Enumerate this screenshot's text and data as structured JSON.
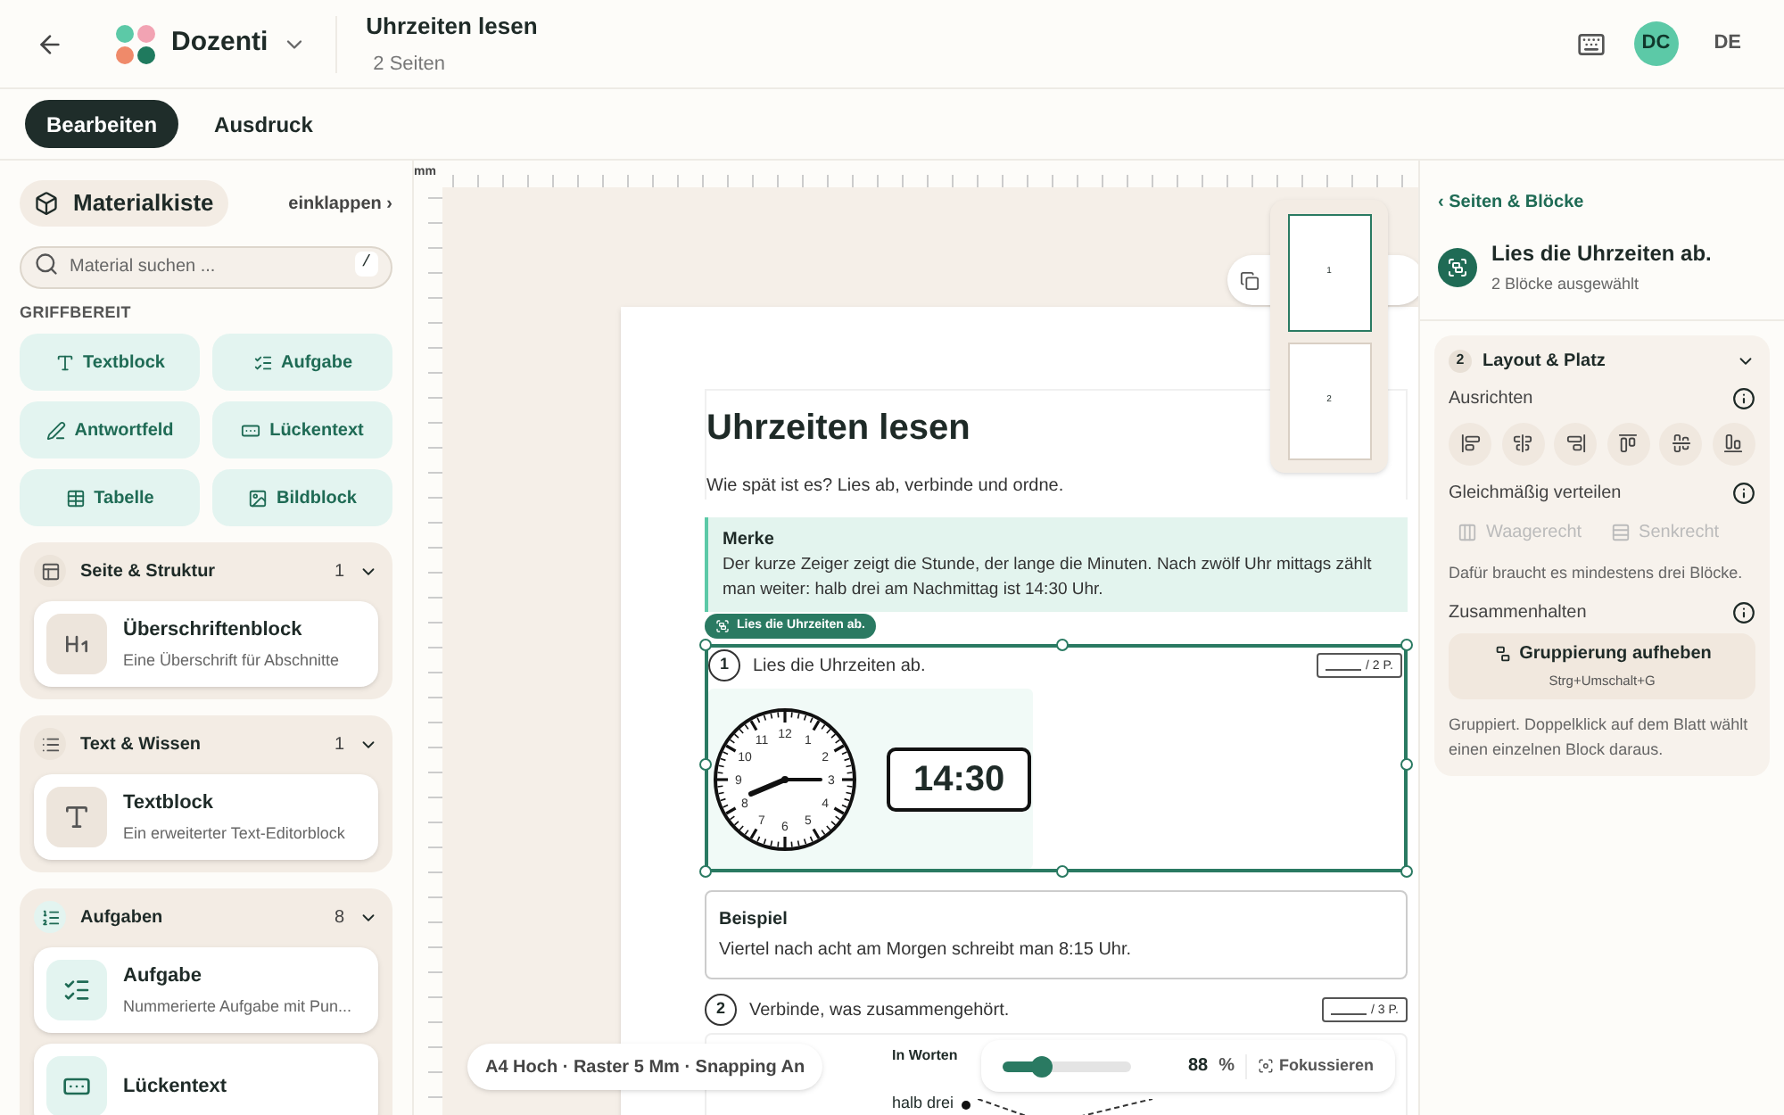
{
  "header": {
    "brand": "Dozenti",
    "title": "Uhrzeiten lesen",
    "subtitle": "2 Seiten",
    "avatar": "DC",
    "language": "DE"
  },
  "tabs": [
    {
      "label": "Bearbeiten",
      "selected": true
    },
    {
      "label": "Ausdruck",
      "selected": false
    }
  ],
  "sidebar": {
    "title": "Materialkiste",
    "collapse": "einklappen ›",
    "search": {
      "placeholder": "Material suchen ...",
      "shortcut": "/"
    },
    "quick_label": "GRIFFBEREIT",
    "quick": [
      "Textblock",
      "Aufgabe",
      "Antwortfeld",
      "Lückentext",
      "Tabelle",
      "Bildblock"
    ],
    "groups": [
      {
        "title": "Seite & Struktur",
        "count": "1",
        "expanded": true,
        "items": [
          {
            "title": "Überschriftenblock",
            "description": "Eine Überschrift für Abschnitte"
          }
        ]
      },
      {
        "title": "Text & Wissen",
        "count": "1",
        "expanded": true,
        "items": [
          {
            "title": "Textblock",
            "description": "Ein erweiterter Text-Editorblock"
          }
        ]
      },
      {
        "title": "Aufgaben",
        "count": "8",
        "expanded": true,
        "items": [
          {
            "title": "Aufgabe",
            "description": "Nummerierte Aufgabe mit Pun..."
          },
          {
            "title": "Lückentext"
          }
        ]
      }
    ]
  },
  "ruler_unit": "mm",
  "minimap": {
    "pages": [
      {
        "label": "1",
        "selected": true
      },
      {
        "label": "2",
        "selected": false
      }
    ]
  },
  "page": {
    "title": "Uhrzeiten lesen",
    "intro": "Wie spät ist es? Lies ab, verbinde und ordne.",
    "note": {
      "title": "Merke",
      "text": "Der kurze Zeiger zeigt die Stunde, der lange die Minuten. Nach zwölf Uhr mittags zählt man weiter: halb drei am Nachmittag ist 14:30 Uhr."
    },
    "selection_label": "Lies die Uhrzeiten ab.",
    "task1": {
      "number": "1",
      "text": "Lies die Uhrzeiten ab.",
      "points": "/ 2 P.",
      "numerals": [
        "12",
        "1",
        "2",
        "3",
        "4",
        "5",
        "6",
        "7",
        "8",
        "9",
        "10",
        "11"
      ],
      "digital": "14:30"
    },
    "example": {
      "title": "Beispiel",
      "text": "Viertel nach acht am Morgen schreibt man 8:15 Uhr."
    },
    "task2": {
      "number": "2",
      "text": "Verbinde, was zusammengehört.",
      "points": "/ 3 P.",
      "column_title": "In Worten",
      "items": [
        "halb drei"
      ]
    }
  },
  "status": "A4 Hoch · Raster 5 Mm · Snapping An",
  "zoom": {
    "level": 0.3,
    "value": "88",
    "unit": "%",
    "focus": "Fokussieren"
  },
  "inspector": {
    "back": "‹ Seiten & Blöcke",
    "title": "Lies die Uhrzeiten ab.",
    "subtitle": "2 Blöcke ausgewählt",
    "section": {
      "number": "2",
      "title": "Layout & Platz",
      "expanded": true,
      "align_label": "Ausrichten",
      "distribute_label": "Gleichmäßig verteilen",
      "distribute": [
        {
          "label": "Waagerecht",
          "disabled": true
        },
        {
          "label": "Senkrecht",
          "disabled": true
        }
      ],
      "distribute_hint": "Dafür braucht es mindestens drei Blöcke.",
      "group_label": "Zusammenhalten",
      "group_button": {
        "label": "Gruppierung aufheben",
        "shortcut": "Strg+Umschalt+G"
      },
      "group_hint": "Gruppiert. Doppelklick auf dem Blatt wählt einen einzelnen Block daraus."
    }
  }
}
